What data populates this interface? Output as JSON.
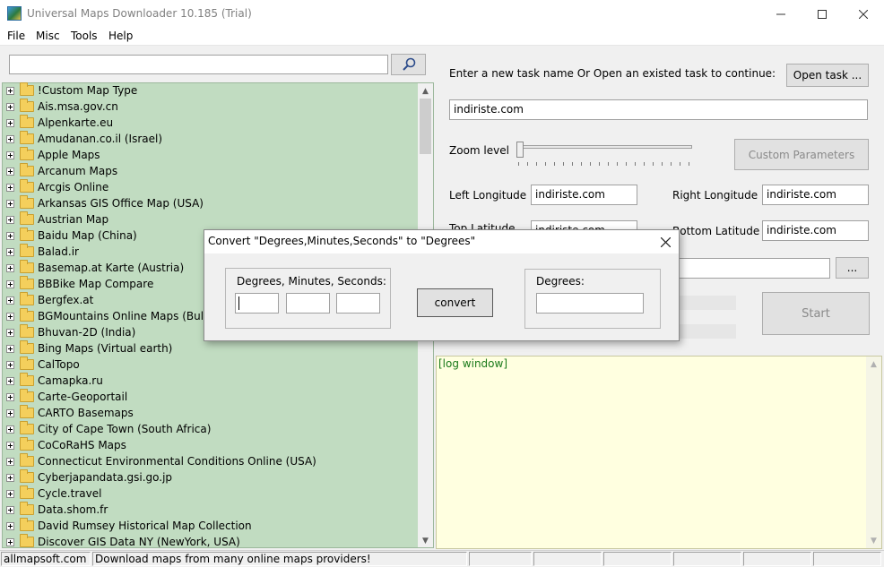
{
  "window": {
    "title": "Universal Maps Downloader 10.185 (Trial)"
  },
  "menu": [
    "File",
    "Misc",
    "Tools",
    "Help"
  ],
  "search": {
    "value": "",
    "icon": "search-icon"
  },
  "tree": {
    "items": [
      "!Custom Map Type",
      "Ais.msa.gov.cn",
      "Alpenkarte.eu",
      "Amudanan.co.il (Israel)",
      "Apple Maps",
      "Arcanum Maps",
      "Arcgis Online",
      "Arkansas GIS Office Map (USA)",
      "Austrian Map",
      "Baidu Map (China)",
      "Balad.ir",
      "Basemap.at Karte (Austria)",
      "BBBike Map Compare",
      "Bergfex.at",
      "BGMountains Online Maps (Bulga",
      "Bhuvan-2D (India)",
      "Bing Maps (Virtual earth)",
      "CalTopo",
      "Camapka.ru",
      "Carte-Geoportail",
      "CARTO Basemaps",
      "City of Cape Town (South Africa)",
      "CoCoRaHS Maps",
      "Connecticut Environmental Conditions Online (USA)",
      "Cyberjapandata.gsi.go.jp",
      "Cycle.travel",
      "Data.shom.fr",
      "David Rumsey Historical Map Collection",
      "Discover GIS Data NY (NewYork, USA)"
    ]
  },
  "task": {
    "prompt": "Enter a new task name Or Open an existed task to continue:",
    "open_button": "Open task ...",
    "name_value": "indiriste.com"
  },
  "zoom": {
    "label": "Zoom level",
    "custom_params_button": "Custom Parameters"
  },
  "coords": {
    "left_longitude_label": "Left Longitude",
    "left_longitude_value": "indiriste.com",
    "right_longitude_label": "Right Longitude",
    "right_longitude_value": "indiriste.com",
    "top_latitude_label": "Top Latitude",
    "top_latitude_value": "indiriste.com",
    "bottom_latitude_label": "Bottom Latitude",
    "bottom_latitude_value": "indiriste.com"
  },
  "path": {
    "browse_button": "...",
    "value": ""
  },
  "start_button": "Start",
  "log": {
    "text": "[log window]"
  },
  "dialog": {
    "title": "Convert \"Degrees,Minutes,Seconds\" to \"Degrees\"",
    "dms_group_label": "Degrees, Minutes, Seconds:",
    "convert_button": "convert",
    "degrees_group_label": "Degrees:"
  },
  "status": {
    "site": "allmapsoft.com",
    "message": "Download maps from many online maps providers!"
  },
  "colors": {
    "tree_background": "#c1dcc1",
    "log_background": "#ffffe0",
    "log_text": "#1a7a1a"
  }
}
